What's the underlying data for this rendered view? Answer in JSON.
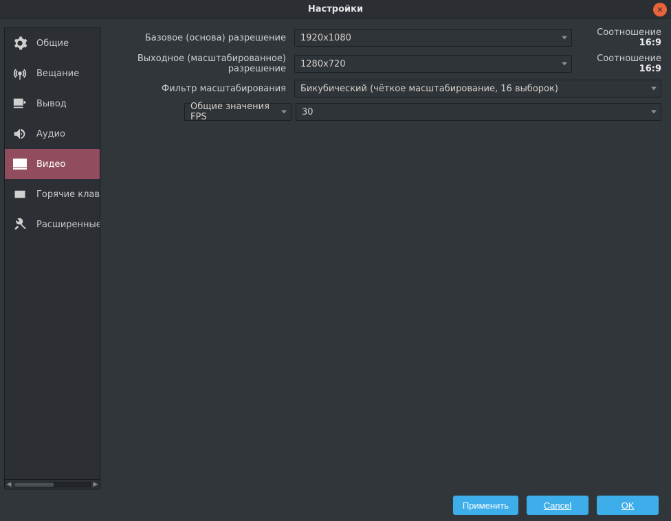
{
  "window": {
    "title": "Настройки"
  },
  "sidebar": {
    "items": [
      {
        "label": "Общие"
      },
      {
        "label": "Вещание"
      },
      {
        "label": "Вывод"
      },
      {
        "label": "Аудио"
      },
      {
        "label": "Видео"
      },
      {
        "label": "Горячие клавиши"
      },
      {
        "label": "Расширенные"
      }
    ]
  },
  "video": {
    "base_res_label": "Базовое (основа) разрешение",
    "base_res_value": "1920x1080",
    "base_res_ratio_label": "Соотношение",
    "base_res_ratio_value": "16:9",
    "output_res_label": "Выходное (масштабированное) разрешение",
    "output_res_value": "1280x720",
    "output_res_ratio_label": "Соотношение",
    "output_res_ratio_value": "16:9",
    "filter_label": "Фильтр масштабирования",
    "filter_value": "Бикубический (чёткое масштабирование, 16 выборок)",
    "fps_mode_label": "Общие значения FPS",
    "fps_value": "30"
  },
  "footer": {
    "apply": "Применить",
    "cancel": "Cancel",
    "ok": "OK"
  }
}
